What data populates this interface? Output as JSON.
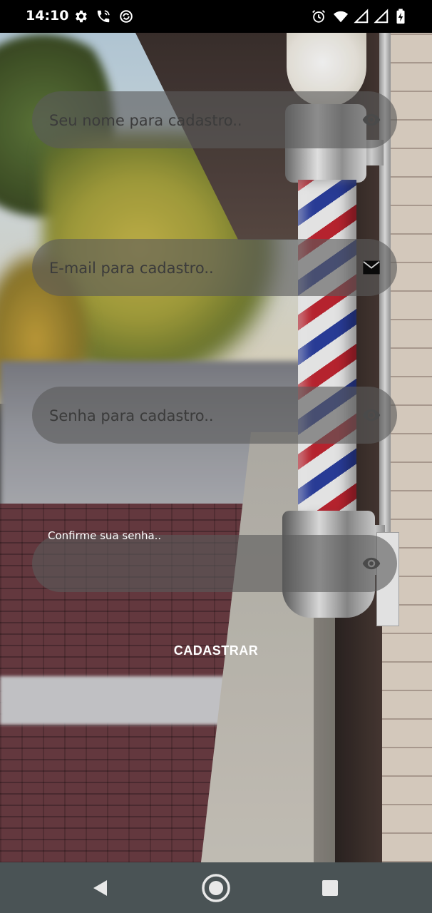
{
  "status_bar": {
    "time": "14:10",
    "left_icons": [
      "gear-icon",
      "wifi-call-icon",
      "sync-icon"
    ],
    "right_icons": [
      "alarm-icon",
      "wifi-icon",
      "signal-icon",
      "signal-icon",
      "battery-charging-icon"
    ]
  },
  "form": {
    "name_field": {
      "placeholder": "Seu nome para cadastro..",
      "value": "",
      "icon": "eye-icon"
    },
    "email_field": {
      "placeholder": "E-mail para cadastro..",
      "value": "",
      "icon": "email-icon"
    },
    "password_field": {
      "placeholder": "Senha para cadastro..",
      "value": "",
      "icon": "eye-icon"
    },
    "confirm_field": {
      "label": "Confirme sua senha..",
      "value": "",
      "icon": "eye-icon"
    },
    "submit_label": "CADASTRAR"
  },
  "nav_bar": {
    "buttons": [
      "back-icon",
      "home-icon",
      "recents-icon"
    ]
  },
  "colors": {
    "status_bar_bg": "#000000",
    "field_bg": "#5a5a5a",
    "nav_bar_bg": "#4a5355",
    "text_light": "#ffffff"
  }
}
